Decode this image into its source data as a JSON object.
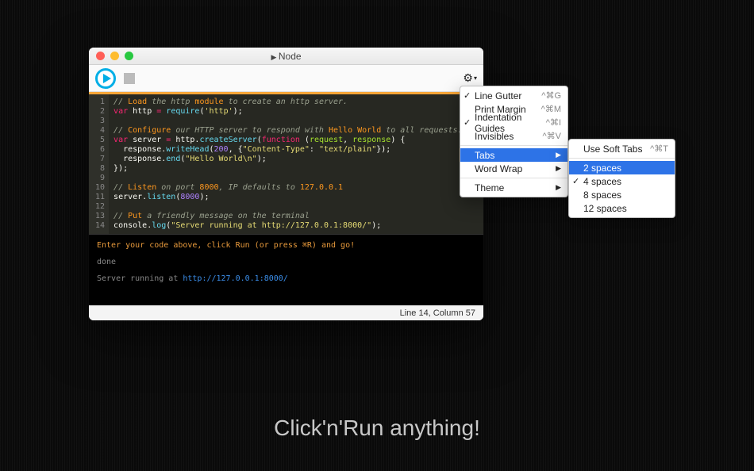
{
  "window": {
    "title": "Node",
    "status": "Line 14, Column 57"
  },
  "code": {
    "lines": [
      [
        {
          "t": "// ",
          "c": "cm"
        },
        {
          "t": "Load",
          "c": "hl"
        },
        {
          "t": " the http ",
          "c": "cm"
        },
        {
          "t": "module",
          "c": "hl"
        },
        {
          "t": " to create an http server.",
          "c": "cm"
        }
      ],
      [
        {
          "t": "var ",
          "c": "kw"
        },
        {
          "t": "http ",
          "c": "id"
        },
        {
          "t": "= ",
          "c": "kw"
        },
        {
          "t": "require",
          "c": "fn"
        },
        {
          "t": "(",
          "c": "id"
        },
        {
          "t": "'http'",
          "c": "str"
        },
        {
          "t": ");",
          "c": "id"
        }
      ],
      [],
      [
        {
          "t": "// ",
          "c": "cm"
        },
        {
          "t": "Configure",
          "c": "hl"
        },
        {
          "t": " our HTTP server to respond with ",
          "c": "cm"
        },
        {
          "t": "Hello World",
          "c": "hl"
        },
        {
          "t": " to all requests.",
          "c": "cm"
        }
      ],
      [
        {
          "t": "var ",
          "c": "kw"
        },
        {
          "t": "server ",
          "c": "id"
        },
        {
          "t": "= ",
          "c": "kw"
        },
        {
          "t": "http.",
          "c": "id"
        },
        {
          "t": "createServer",
          "c": "fn"
        },
        {
          "t": "(",
          "c": "id"
        },
        {
          "t": "function",
          "c": "kw"
        },
        {
          "t": " (",
          "c": "id"
        },
        {
          "t": "request",
          "c": "var"
        },
        {
          "t": ", ",
          "c": "id"
        },
        {
          "t": "response",
          "c": "var"
        },
        {
          "t": ") {",
          "c": "id"
        }
      ],
      [
        {
          "t": "  response.",
          "c": "id"
        },
        {
          "t": "writeHead",
          "c": "fn"
        },
        {
          "t": "(",
          "c": "id"
        },
        {
          "t": "200",
          "c": "num"
        },
        {
          "t": ", {",
          "c": "id"
        },
        {
          "t": "\"Content-Type\"",
          "c": "str"
        },
        {
          "t": ": ",
          "c": "id"
        },
        {
          "t": "\"text/plain\"",
          "c": "str"
        },
        {
          "t": "});",
          "c": "id"
        }
      ],
      [
        {
          "t": "  response.",
          "c": "id"
        },
        {
          "t": "end",
          "c": "fn"
        },
        {
          "t": "(",
          "c": "id"
        },
        {
          "t": "\"Hello World\\n\"",
          "c": "str"
        },
        {
          "t": ");",
          "c": "id"
        }
      ],
      [
        {
          "t": "});",
          "c": "id"
        }
      ],
      [],
      [
        {
          "t": "// ",
          "c": "cm"
        },
        {
          "t": "Listen",
          "c": "hl"
        },
        {
          "t": " on port ",
          "c": "cm"
        },
        {
          "t": "8000",
          "c": "hl"
        },
        {
          "t": ", IP defaults to ",
          "c": "cm"
        },
        {
          "t": "127.0.0.1",
          "c": "hl"
        }
      ],
      [
        {
          "t": "server.",
          "c": "id"
        },
        {
          "t": "listen",
          "c": "fn"
        },
        {
          "t": "(",
          "c": "id"
        },
        {
          "t": "8000",
          "c": "num"
        },
        {
          "t": ");",
          "c": "id"
        }
      ],
      [],
      [
        {
          "t": "// ",
          "c": "cm"
        },
        {
          "t": "Put",
          "c": "hl"
        },
        {
          "t": " a friendly message on the terminal",
          "c": "cm"
        }
      ],
      [
        {
          "t": "console.",
          "c": "id"
        },
        {
          "t": "log",
          "c": "fn"
        },
        {
          "t": "(",
          "c": "id"
        },
        {
          "t": "\"Server running at http://127.0.0.1:8000/\"",
          "c": "str"
        },
        {
          "t": ");",
          "c": "id"
        }
      ]
    ]
  },
  "console": {
    "hint": "Enter your code above, click Run (or press ⌘R) and go!",
    "line1": "done",
    "line2_pre": "Server running at ",
    "line2_url": "http://127.0.0.1:8000/"
  },
  "menu1": [
    {
      "label": "Line Gutter",
      "shortcut": "^⌘G",
      "checked": true
    },
    {
      "label": "Print Margin",
      "shortcut": "^⌘M",
      "checked": false
    },
    {
      "label": "Indentation Guides",
      "shortcut": "^⌘I",
      "checked": true
    },
    {
      "label": "Invisibles",
      "shortcut": "^⌘V",
      "checked": false
    },
    {
      "sep": true
    },
    {
      "label": "Tabs",
      "submenu": true,
      "highlight": true
    },
    {
      "label": "Word Wrap",
      "submenu": true
    },
    {
      "sep": true
    },
    {
      "label": "Theme",
      "submenu": true
    }
  ],
  "menu2": [
    {
      "label": "Use Soft Tabs",
      "shortcut": "^⌘T"
    },
    {
      "sep": true
    },
    {
      "label": "2 spaces",
      "highlight": true
    },
    {
      "label": "4 spaces",
      "checked": true
    },
    {
      "label": "8 spaces"
    },
    {
      "label": "12 spaces"
    }
  ],
  "tagline": "Click'n'Run anything!"
}
